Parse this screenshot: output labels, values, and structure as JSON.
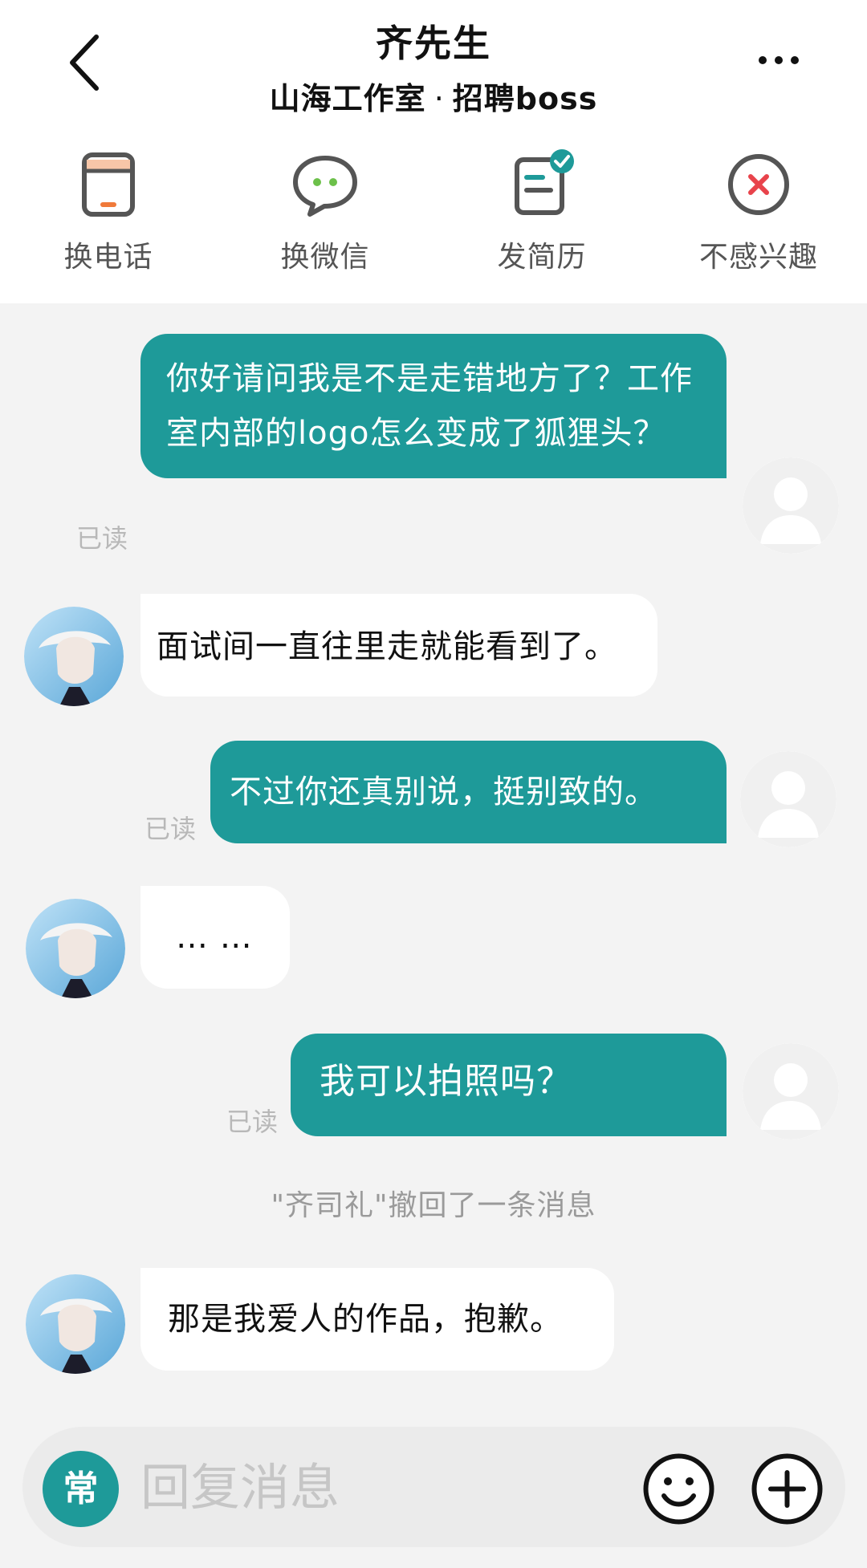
{
  "header": {
    "title": "齐先生",
    "company": "山海工作室",
    "separator": "·",
    "position": "招聘boss"
  },
  "actions": [
    {
      "label": "换电话",
      "icon": "phone-icon"
    },
    {
      "label": "换微信",
      "icon": "wechat-icon"
    },
    {
      "label": "发简历",
      "icon": "resume-icon"
    },
    {
      "label": "不感兴趣",
      "icon": "not-interested-icon"
    }
  ],
  "messages": [
    {
      "side": "out",
      "text": "你好请问我是不是走错地方了？工作室内部的logo怎么变成了狐狸头？",
      "status": "已读"
    },
    {
      "side": "in",
      "text": "面试间一直往里走就能看到了。"
    },
    {
      "side": "out",
      "text": "不过你还真别说，挺别致的。",
      "status": "已读"
    },
    {
      "side": "in",
      "text": "… …"
    },
    {
      "side": "out",
      "text": "我可以拍照吗？",
      "status": "已读"
    },
    {
      "side": "system",
      "text": "\"齐司礼\"撤回了一条消息"
    },
    {
      "side": "in",
      "text": "那是我爱人的作品，抱歉。"
    }
  ],
  "composer": {
    "common_label": "常",
    "placeholder": "回复消息"
  },
  "colors": {
    "accent": "#1e9a99",
    "background": "#f3f3f3",
    "incoming_bubble": "#ffffff"
  }
}
